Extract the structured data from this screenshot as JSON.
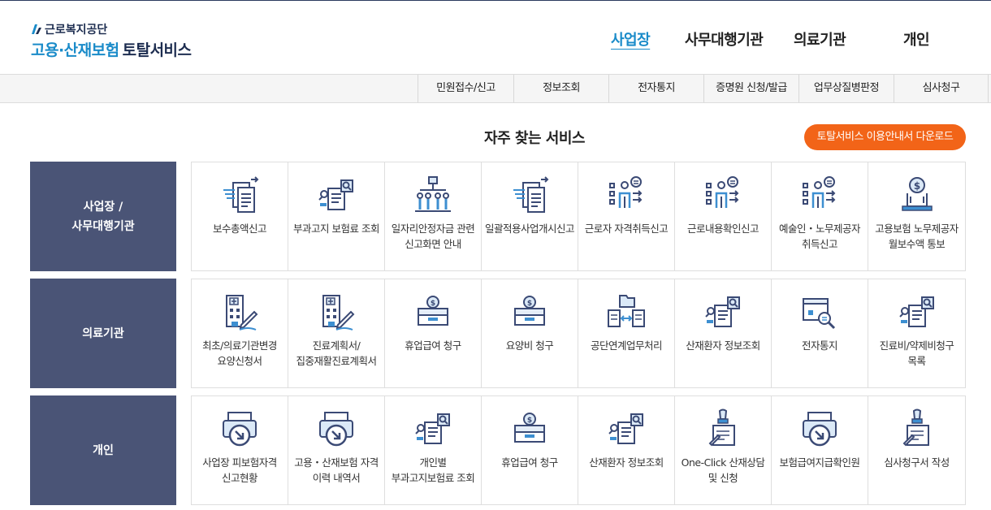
{
  "header": {
    "org_name": "근로복지공단",
    "service_name_a": "고용·산재보험",
    "service_name_b": "토탈서비스"
  },
  "gnb": [
    {
      "label": "사업장",
      "active": true
    },
    {
      "label": "사무대행기관",
      "active": false
    },
    {
      "label": "의료기관",
      "active": false
    },
    {
      "label": "개인",
      "active": false
    }
  ],
  "subnav": [
    "민원접수/신고",
    "정보조회",
    "전자통지",
    "증명원 신청/발급",
    "업무상질병판정",
    "심사청구"
  ],
  "section_title": "자주 찾는 서비스",
  "download_button": "토탈서비스 이용안내서 다운로드",
  "colors": {
    "accent": "#1a8bc9",
    "navy": "#1d2d50",
    "category_bg": "#4a5476",
    "orange": "#f26418"
  },
  "rows": [
    {
      "category": "사업장 /\n사무대행기관",
      "items": [
        {
          "label": "보수총액신고",
          "icon": "document-transfer-icon"
        },
        {
          "label": "부과고지 보험료 조회",
          "icon": "document-search-icon"
        },
        {
          "label": "일자리안정자금 관련 신고화면 안내",
          "icon": "organization-icon"
        },
        {
          "label": "일괄적용사업개시신고",
          "icon": "document-transfer-icon"
        },
        {
          "label": "근로자 자격취득신고",
          "icon": "person-checklist-icon"
        },
        {
          "label": "근로내용확인신고",
          "icon": "person-checklist-icon"
        },
        {
          "label": "예술인・노무제공자 취득신고",
          "icon": "person-checklist-icon"
        },
        {
          "label": "고용보험 노무제공자 월보수액 통보",
          "icon": "money-laptop-icon"
        }
      ]
    },
    {
      "category": "의료기관",
      "items": [
        {
          "label": "최초/의료기관변경 요양신청서",
          "icon": "hospital-pen-icon"
        },
        {
          "label": "진료계획서/집중재활진료계획서",
          "icon": "hospital-pen-icon"
        },
        {
          "label": "휴업급여 청구",
          "icon": "money-box-icon"
        },
        {
          "label": "요양비 청구",
          "icon": "money-box-icon"
        },
        {
          "label": "공단연계업무처리",
          "icon": "folder-exchange-icon"
        },
        {
          "label": "산재환자 정보조회",
          "icon": "document-search-icon"
        },
        {
          "label": "전자통지",
          "icon": "box-magnifier-icon"
        },
        {
          "label": "진료비/약제비청구 목록",
          "icon": "document-search-icon"
        }
      ]
    },
    {
      "category": "개인",
      "items": [
        {
          "label": "사업장 피보험자격 신고현황",
          "icon": "printer-arrow-icon"
        },
        {
          "label": "고용・산재보험 자격 이력 내역서",
          "icon": "printer-arrow-icon"
        },
        {
          "label": "개인별 부과고지보험료 조회",
          "icon": "document-search-icon"
        },
        {
          "label": "휴업급여 청구",
          "icon": "money-box-icon"
        },
        {
          "label": "산재환자 정보조회",
          "icon": "document-search-icon"
        },
        {
          "label": "One-Click 산재상담 및 신청",
          "icon": "stamp-document-icon"
        },
        {
          "label": "보험급여지급확인원",
          "icon": "printer-arrow-icon"
        },
        {
          "label": "심사청구서 작성",
          "icon": "stamp-document-icon"
        }
      ]
    }
  ]
}
